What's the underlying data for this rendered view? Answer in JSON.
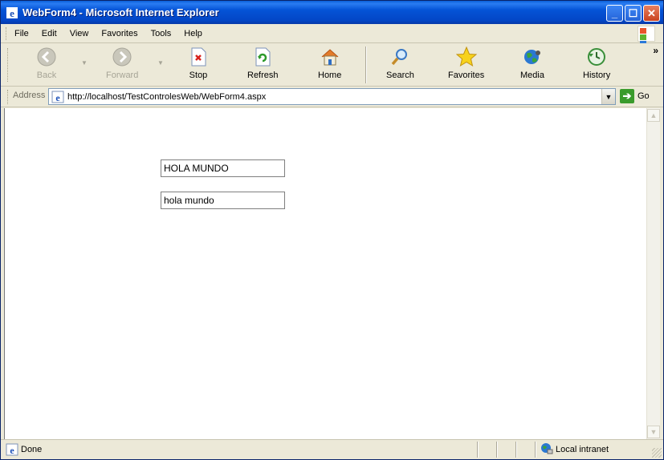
{
  "window": {
    "title": "WebForm4 - Microsoft Internet Explorer",
    "app_icon": "ie-icon"
  },
  "menubar": {
    "items": [
      "File",
      "Edit",
      "View",
      "Favorites",
      "Tools",
      "Help"
    ]
  },
  "toolbar": {
    "back_label": "Back",
    "forward_label": "Forward",
    "stop_label": "Stop",
    "refresh_label": "Refresh",
    "home_label": "Home",
    "search_label": "Search",
    "favorites_label": "Favorites",
    "media_label": "Media",
    "history_label": "History",
    "more_label": "»"
  },
  "address": {
    "label": "Address",
    "url": "http://localhost/TestControlesWeb/WebForm4.aspx",
    "go_label": "Go"
  },
  "content": {
    "textbox1_value": "HOLA MUNDO",
    "textbox2_value": "hola mundo"
  },
  "statusbar": {
    "status": "Done",
    "zone": "Local intranet"
  },
  "colors": {
    "titlebar": "#0453d6",
    "chrome": "#ece9d8",
    "go_green": "#3a9b2c"
  }
}
